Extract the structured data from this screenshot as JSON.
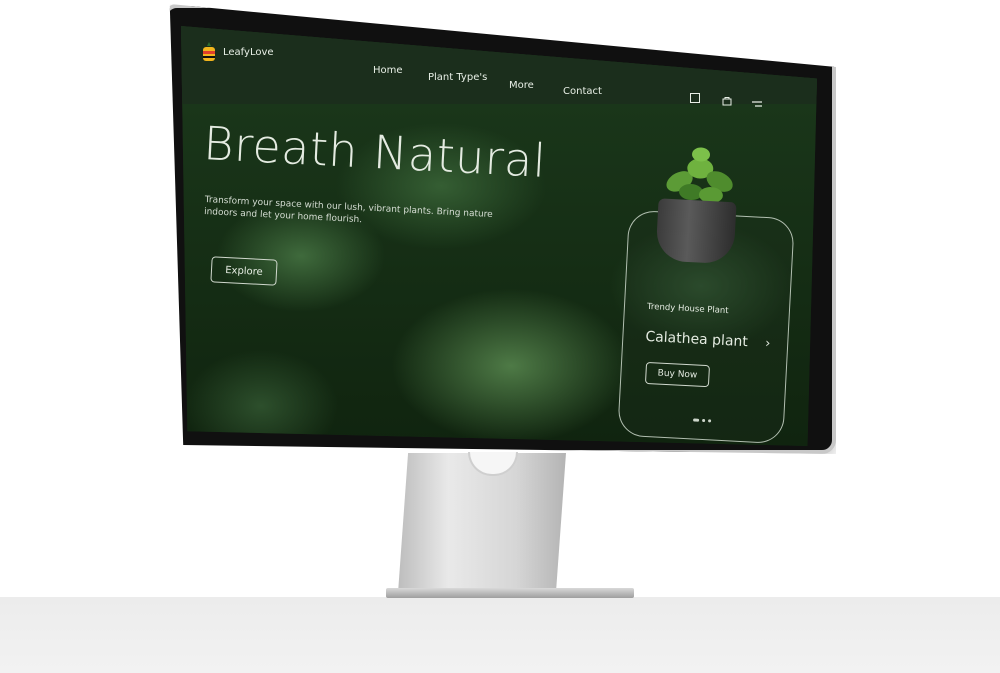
{
  "brand": {
    "name": "LeafyLove"
  },
  "nav": {
    "links": [
      "Home",
      "Plant Type's",
      "More",
      "Contact"
    ],
    "icons": [
      "bookmark-icon",
      "cart-icon",
      "menu-icon"
    ]
  },
  "hero": {
    "title": "Breath Natural",
    "text": "Transform your space with our lush, vibrant plants. Bring nature indoors and let your home flourish.",
    "cta": "Explore"
  },
  "card": {
    "subtitle": "Trendy House Plant",
    "title": "Calathea plant",
    "arrow": "›",
    "cta": "Buy Now",
    "carousel_active_index": 0,
    "carousel_count": 3
  },
  "colors": {
    "navbar": "#1b2e1c",
    "text": "#e4ebe1",
    "leaf": "#3f6a3c"
  }
}
